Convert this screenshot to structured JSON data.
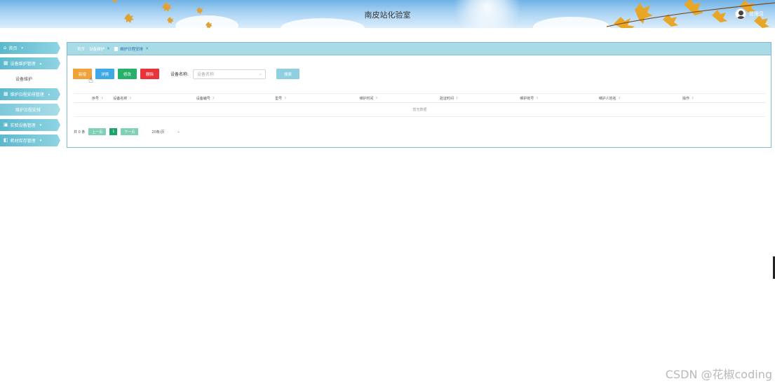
{
  "header": {
    "title": "南皮站化验室",
    "user_name": "管理员"
  },
  "sidebar": {
    "items": [
      {
        "label": "首页",
        "icon": "home-icon"
      },
      {
        "label": "设备维护管理",
        "icon": "grid-icon"
      },
      {
        "label": "设备维护",
        "sub": true
      },
      {
        "label": "维护日程安排管理",
        "icon": "grid-icon"
      },
      {
        "label": "维护日程安排",
        "sub": true,
        "active": true
      },
      {
        "label": "实验设备管理",
        "icon": "device-icon"
      },
      {
        "label": "耗材库存管理",
        "icon": "box-icon"
      }
    ]
  },
  "tabs": [
    {
      "label": "首页"
    },
    {
      "label": "设备维护"
    },
    {
      "label": "维护日程安排"
    }
  ],
  "toolbar": {
    "add": "新增",
    "detail": "详情",
    "edit": "修改",
    "delete": "删除",
    "search_label": "设备名称:",
    "search_placeholder": "设备名称",
    "search_button": "搜索"
  },
  "table": {
    "columns": [
      "序号",
      "设备名称",
      "设备编号",
      "型号",
      "维护时间",
      "验证时间",
      "维护账号",
      "维护人姓名",
      "操作"
    ],
    "empty_text": "暂无数据"
  },
  "pager": {
    "total": "共 0 条",
    "prev": "上一页",
    "page": "1",
    "next": "下一页",
    "size": "20条/页",
    "size_chev": "⌄"
  },
  "watermark": "CSDN @花椒coding",
  "colors": {
    "accent": "#5bb8cc",
    "add": "#f0a33a",
    "detail": "#3fa9e8",
    "edit": "#26b06a",
    "delete": "#e8333b"
  }
}
